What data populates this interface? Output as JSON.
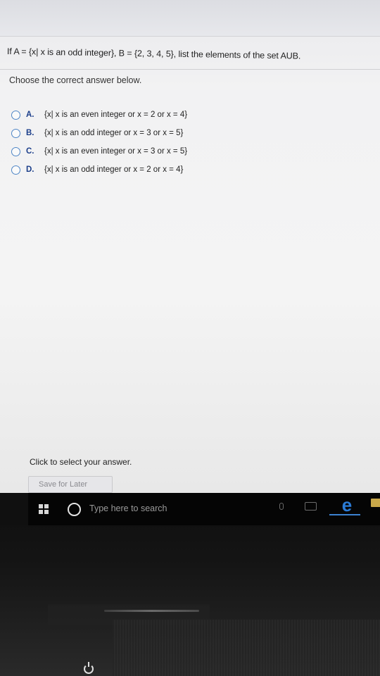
{
  "question": "If A = {x| x is an odd integer}, B = {2, 3, 4, 5}, list the elements of the set AUB.",
  "prompt": "Choose the correct answer below.",
  "choices": [
    {
      "letter": "A.",
      "text": "{x| x is an even integer or x = 2 or x = 4}"
    },
    {
      "letter": "B.",
      "text": "{x| x is an odd integer or x = 3 or x = 5}"
    },
    {
      "letter": "C.",
      "text": "{x| x is an even integer or x = 3 or x = 5}"
    },
    {
      "letter": "D.",
      "text": "{x| x is an odd integer or x = 2 or x = 4}"
    }
  ],
  "footer": {
    "click_note": "Click to select your answer.",
    "save_label": "Save for Later"
  },
  "taskbar": {
    "search_placeholder": "Type here to search",
    "icons": [
      "windows-start-icon",
      "cortana-icon",
      "microphone-icon",
      "task-view-icon",
      "edge-browser-icon",
      "file-explorer-icon"
    ]
  },
  "colors": {
    "radio_border": "#4f86c6",
    "choice_letter": "#1b3e8a",
    "edge_blue": "#2b7bd6"
  }
}
